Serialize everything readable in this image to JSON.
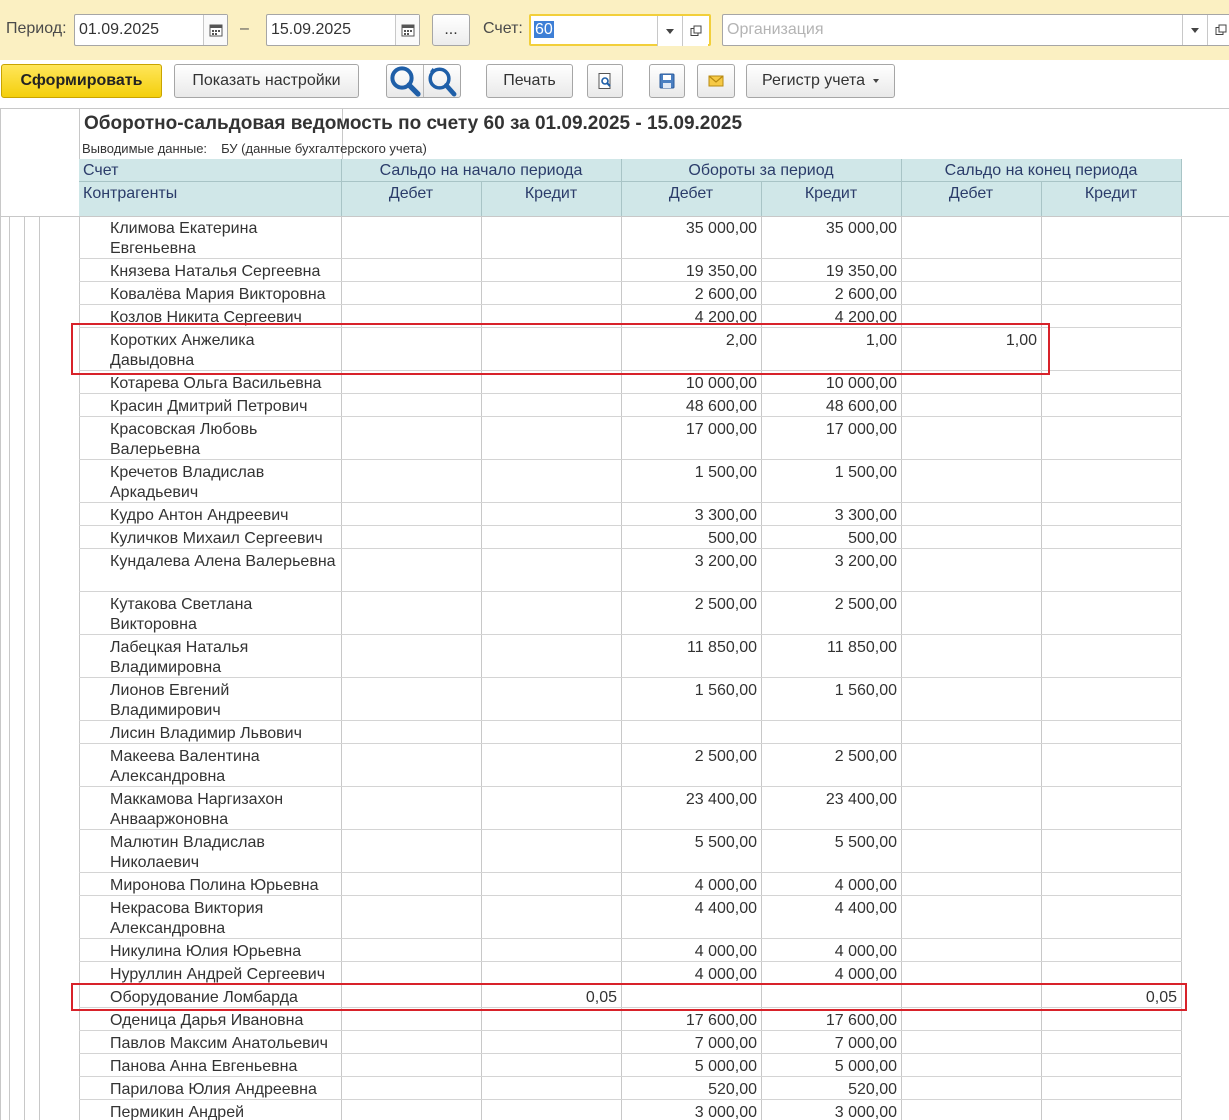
{
  "filter": {
    "period_label": "Период:",
    "date_from": "01.09.2025",
    "dash": "–",
    "date_to": "15.09.2025",
    "ellipsis": "...",
    "account_label": "Счет:",
    "account_value": "60",
    "organization_placeholder": "Организация"
  },
  "toolbar": {
    "generate": "Сформировать",
    "show_settings": "Показать настройки",
    "print": "Печать",
    "register": "Регистр учета"
  },
  "report": {
    "title": "Оборотно-сальдовая ведомость по счету 60 за 01.09.2025 - 15.09.2025",
    "subtitle_label": "Выводимые данные:",
    "subtitle_value": "БУ (данные бухгалтерского учета)",
    "headers": {
      "account": "Счет",
      "counterparties": "Контрагенты",
      "opening": "Сальдо на начало периода",
      "turnover": "Обороты за период",
      "closing": "Сальдо на конец периода",
      "debit": "Дебет",
      "credit": "Кредит"
    },
    "rows": [
      {
        "name": "Климова Екатерина Евгеньевна",
        "od": "",
        "oc": "",
        "td": "35 000,00",
        "tc": "35 000,00",
        "cd": "",
        "cc": ""
      },
      {
        "name": "Князева Наталья Сергеевна",
        "od": "",
        "oc": "",
        "td": "19 350,00",
        "tc": "19 350,00",
        "cd": "",
        "cc": ""
      },
      {
        "name": "Ковалёва Мария Викторовна",
        "od": "",
        "oc": "",
        "td": "2 600,00",
        "tc": "2 600,00",
        "cd": "",
        "cc": ""
      },
      {
        "name": "Козлов Никита Сергеевич",
        "od": "",
        "oc": "",
        "td": "4 200,00",
        "tc": "4 200,00",
        "cd": "",
        "cc": ""
      },
      {
        "name": "Коротких Анжелика Давыдовна",
        "od": "",
        "oc": "",
        "td": "2,00",
        "tc": "1,00",
        "cd": "1,00",
        "cc": ""
      },
      {
        "name": "Котарева Ольга Васильевна",
        "od": "",
        "oc": "",
        "td": "10 000,00",
        "tc": "10 000,00",
        "cd": "",
        "cc": ""
      },
      {
        "name": "Красин Дмитрий Петрович",
        "od": "",
        "oc": "",
        "td": "48 600,00",
        "tc": "48 600,00",
        "cd": "",
        "cc": ""
      },
      {
        "name": "Красовская Любовь Валерьевна",
        "od": "",
        "oc": "",
        "td": "17 000,00",
        "tc": "17 000,00",
        "cd": "",
        "cc": ""
      },
      {
        "name": "Кречетов Владислав Аркадьевич",
        "od": "",
        "oc": "",
        "td": "1 500,00",
        "tc": "1 500,00",
        "cd": "",
        "cc": ""
      },
      {
        "name": "Кудро Антон Андреевич",
        "od": "",
        "oc": "",
        "td": "3 300,00",
        "tc": "3 300,00",
        "cd": "",
        "cc": ""
      },
      {
        "name": "Куличков Михаил Сергеевич",
        "od": "",
        "oc": "",
        "td": "500,00",
        "tc": "500,00",
        "cd": "",
        "cc": ""
      },
      {
        "name": "Кундалева Алена Валерьевна",
        "od": "",
        "oc": "",
        "td": "3 200,00",
        "tc": "3 200,00",
        "cd": "",
        "cc": ""
      },
      {
        "name": "Кутакова Светлана Викторовна",
        "od": "",
        "oc": "",
        "td": "2 500,00",
        "tc": "2 500,00",
        "cd": "",
        "cc": ""
      },
      {
        "name": "Лабецкая Наталья Владимировна",
        "od": "",
        "oc": "",
        "td": "11 850,00",
        "tc": "11 850,00",
        "cd": "",
        "cc": ""
      },
      {
        "name": "Лионов Евгений Владимирович",
        "od": "",
        "oc": "",
        "td": "1 560,00",
        "tc": "1 560,00",
        "cd": "",
        "cc": ""
      },
      {
        "name": "Лисин Владимир Львович",
        "od": "",
        "oc": "",
        "td": "",
        "tc": "",
        "cd": "",
        "cc": ""
      },
      {
        "name": "Макеева Валентина Александровна",
        "od": "",
        "oc": "",
        "td": "2 500,00",
        "tc": "2 500,00",
        "cd": "",
        "cc": ""
      },
      {
        "name": "Маккамова Наргизахон Анвааржоновна",
        "od": "",
        "oc": "",
        "td": "23 400,00",
        "tc": "23 400,00",
        "cd": "",
        "cc": ""
      },
      {
        "name": "Малютин Владислав Николаевич",
        "od": "",
        "oc": "",
        "td": "5 500,00",
        "tc": "5 500,00",
        "cd": "",
        "cc": ""
      },
      {
        "name": "Миронова Полина Юрьевна",
        "od": "",
        "oc": "",
        "td": "4 000,00",
        "tc": "4 000,00",
        "cd": "",
        "cc": ""
      },
      {
        "name": "Некрасова Виктория Александровна",
        "od": "",
        "oc": "",
        "td": "4 400,00",
        "tc": "4 400,00",
        "cd": "",
        "cc": ""
      },
      {
        "name": "Никулина Юлия Юрьевна",
        "od": "",
        "oc": "",
        "td": "4 000,00",
        "tc": "4 000,00",
        "cd": "",
        "cc": ""
      },
      {
        "name": "Нуруллин Андрей Сергеевич",
        "od": "",
        "oc": "",
        "td": "4 000,00",
        "tc": "4 000,00",
        "cd": "",
        "cc": ""
      },
      {
        "name": "Оборудование Ломбарда",
        "od": "",
        "oc": "0,05",
        "td": "",
        "tc": "",
        "cd": "",
        "cc": "0,05"
      },
      {
        "name": "Оденица Дарья Ивановна",
        "od": "",
        "oc": "",
        "td": "17 600,00",
        "tc": "17 600,00",
        "cd": "",
        "cc": ""
      },
      {
        "name": "Павлов Максим Анатольевич",
        "od": "",
        "oc": "",
        "td": "7 000,00",
        "tc": "7 000,00",
        "cd": "",
        "cc": ""
      },
      {
        "name": "Панова Анна Евгеньевна",
        "od": "",
        "oc": "",
        "td": "5 000,00",
        "tc": "5 000,00",
        "cd": "",
        "cc": ""
      },
      {
        "name": "Парилова Юлия Андреевна",
        "od": "",
        "oc": "",
        "td": "520,00",
        "tc": "520,00",
        "cd": "",
        "cc": ""
      },
      {
        "name": "Пермикин Андрей",
        "od": "",
        "oc": "",
        "td": "3 000,00",
        "tc": "3 000,00",
        "cd": "",
        "cc": ""
      }
    ]
  },
  "colors": {
    "filter_bar": "#fbf0c2",
    "primary_button": "#f4cf0c",
    "header_bg": "#d0e7e8",
    "header_text": "#2b3c6a",
    "highlight": "#d8222a",
    "selection": "#3e7fd6"
  },
  "icons": [
    "calendar-icon",
    "dropdown-arrow-icon",
    "open-form-icon",
    "search-icon",
    "search-refresh-icon",
    "print-preview-icon",
    "save-icon",
    "email-icon"
  ]
}
